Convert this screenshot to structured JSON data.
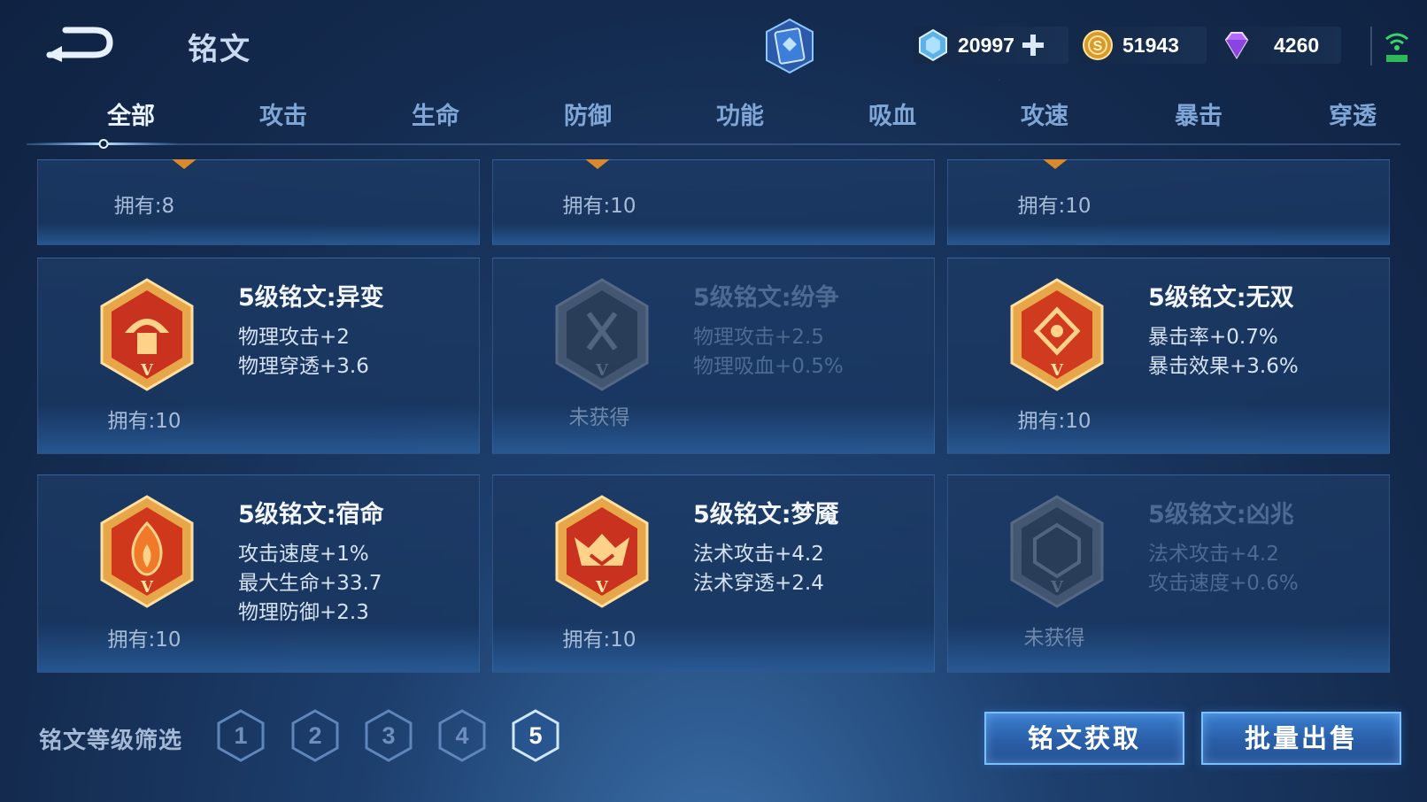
{
  "header": {
    "title": "铭文",
    "currencies": [
      {
        "icon": "diamond-coupon-icon",
        "value": "20997"
      },
      {
        "icon": "gold-coin-icon",
        "value": "51943"
      },
      {
        "icon": "purple-gem-icon",
        "value": "4260"
      }
    ]
  },
  "tabs": [
    "全部",
    "攻击",
    "生命",
    "防御",
    "功能",
    "吸血",
    "攻速",
    "暴击",
    "穿透"
  ],
  "cards_top": [
    {
      "owned": "拥有:8"
    },
    {
      "owned": "拥有:10"
    },
    {
      "owned": "拥有:10"
    }
  ],
  "cards": [
    {
      "name": "5级铭文:异变",
      "stats": [
        "物理攻击+2",
        "物理穿透+3.6"
      ],
      "owned": "拥有:10",
      "locked": false
    },
    {
      "name": "5级铭文:纷争",
      "stats": [
        "物理攻击+2.5",
        "物理吸血+0.5%"
      ],
      "owned": "未获得",
      "locked": true
    },
    {
      "name": "5级铭文:无双",
      "stats": [
        "暴击率+0.7%",
        "暴击效果+3.6%"
      ],
      "owned": "拥有:10",
      "locked": false
    },
    {
      "name": "5级铭文:宿命",
      "stats": [
        "攻击速度+1%",
        "最大生命+33.7",
        "物理防御+2.3"
      ],
      "owned": "拥有:10",
      "locked": false
    },
    {
      "name": "5级铭文:梦魇",
      "stats": [
        "法术攻击+4.2",
        "法术穿透+2.4"
      ],
      "owned": "拥有:10",
      "locked": false
    },
    {
      "name": "5级铭文:凶兆",
      "stats": [
        "法术攻击+4.2",
        "攻击速度+0.6%"
      ],
      "owned": "未获得",
      "locked": true
    }
  ],
  "bottom": {
    "filter_label": "铭文等级筛选",
    "levels": [
      "1",
      "2",
      "3",
      "4",
      "5"
    ],
    "active_level": "5",
    "obtain_button": "铭文获取",
    "sell_button": "批量出售"
  },
  "colors": {
    "accent": "#7ac0ff",
    "gem_red": "#c8321e",
    "gem_gold": "#e8a64a",
    "tab_inactive": "#7fa6d6"
  }
}
